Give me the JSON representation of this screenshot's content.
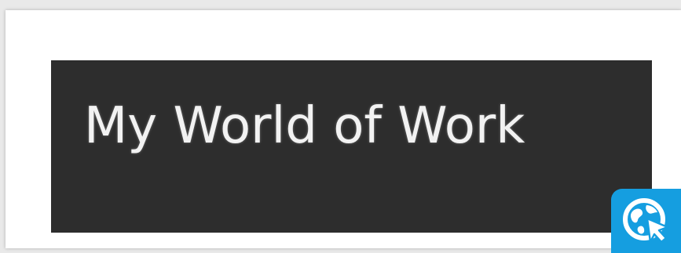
{
  "banner": {
    "title": "My World of Work",
    "background_color": "#2d2d2d",
    "text_color": "#f2f2f2"
  },
  "badge": {
    "icon": "globe-cursor-icon",
    "background_color": "#159ee0"
  }
}
